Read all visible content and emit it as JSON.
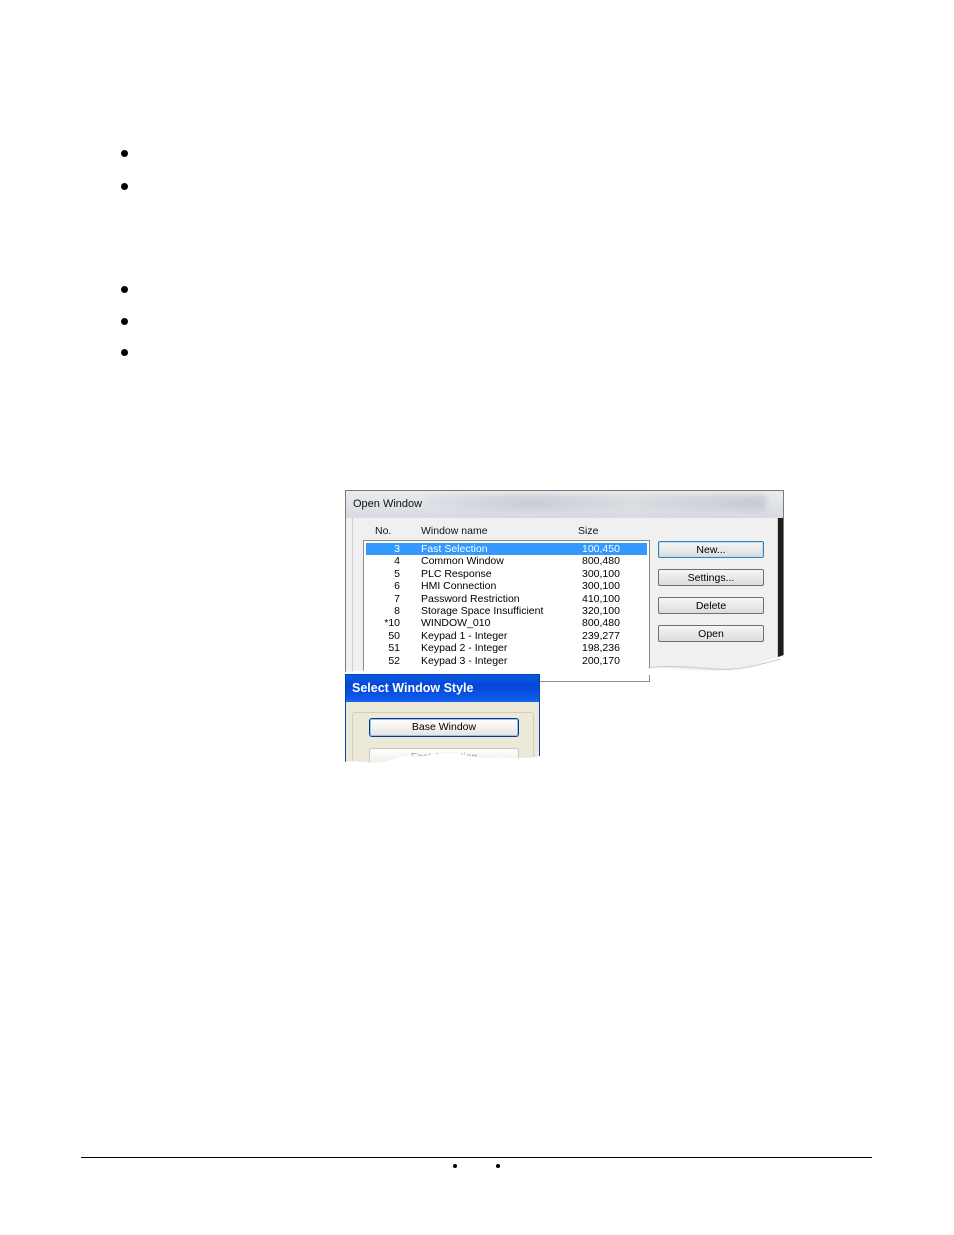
{
  "open_window": {
    "title": "Open Window",
    "columns": [
      "No.",
      "Window name",
      "Size"
    ],
    "rows": [
      {
        "no": "3",
        "name": "Fast Selection",
        "size": "100,450",
        "selected": true
      },
      {
        "no": "4",
        "name": "Common Window",
        "size": "800,480"
      },
      {
        "no": "5",
        "name": "PLC Response",
        "size": "300,100"
      },
      {
        "no": "6",
        "name": "HMI Connection",
        "size": "300,100"
      },
      {
        "no": "7",
        "name": "Password Restriction",
        "size": "410,100"
      },
      {
        "no": "8",
        "name": "Storage Space Insufficient",
        "size": "320,100"
      },
      {
        "no": "*10",
        "name": "WINDOW_010",
        "size": "800,480"
      },
      {
        "no": "50",
        "name": "Keypad 1 - Integer",
        "size": "239,277"
      },
      {
        "no": "51",
        "name": "Keypad 2 - Integer",
        "size": "198,236"
      },
      {
        "no": "52",
        "name": "Keypad 3 - Integer",
        "size": "200,170"
      }
    ],
    "buttons": {
      "new": "New...",
      "settings": "Settings...",
      "delete": "Delete",
      "open": "Open"
    },
    "selection_color": "#3399ff"
  },
  "select_window_style": {
    "title": "Select Window Style",
    "buttons": {
      "base_window": "Base Window",
      "fast_selection": "Fast Selection"
    },
    "title_color": "#0448d6"
  }
}
